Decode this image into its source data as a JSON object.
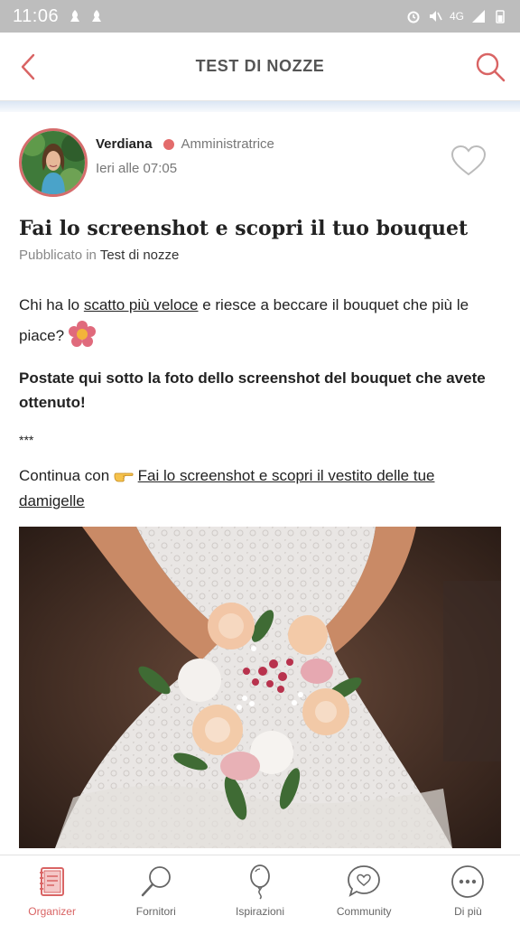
{
  "status_bar": {
    "time": "11:06",
    "network": "4G"
  },
  "header": {
    "title": "TEST DI NOZZE",
    "back_icon": "chevron-left-icon",
    "search_icon": "search-icon",
    "accent_color": "#d96464"
  },
  "post": {
    "author": {
      "name": "Verdiana",
      "role": "Amministratrice",
      "time": "Ieri alle 07:05"
    },
    "title": "Fai lo screenshot e scopri il tuo bouquet",
    "published_prefix": "Pubblicato in",
    "forum": "Test di nozze",
    "paragraph1_before": "Chi ha lo",
    "paragraph1_link": "scatto più veloce",
    "paragraph1_after": "e riesce a beccare il bouquet che più le piace?",
    "paragraph2": "Postate qui sotto la foto dello screenshot del bouquet che avete ottenuto!",
    "separator": "***",
    "continue_prefix": "Continua con",
    "continue_link": "Fai lo screenshot e scopri il vestito delle tue damigelle"
  },
  "bottom_nav": {
    "items": [
      {
        "label": "Organizer",
        "icon": "organizer-icon",
        "active": true
      },
      {
        "label": "Fornitori",
        "icon": "fornitori-icon",
        "active": false
      },
      {
        "label": "Ispirazioni",
        "icon": "ispirazioni-icon",
        "active": false
      },
      {
        "label": "Community",
        "icon": "community-icon",
        "active": false
      },
      {
        "label": "Di più",
        "icon": "more-icon",
        "active": false
      }
    ]
  }
}
